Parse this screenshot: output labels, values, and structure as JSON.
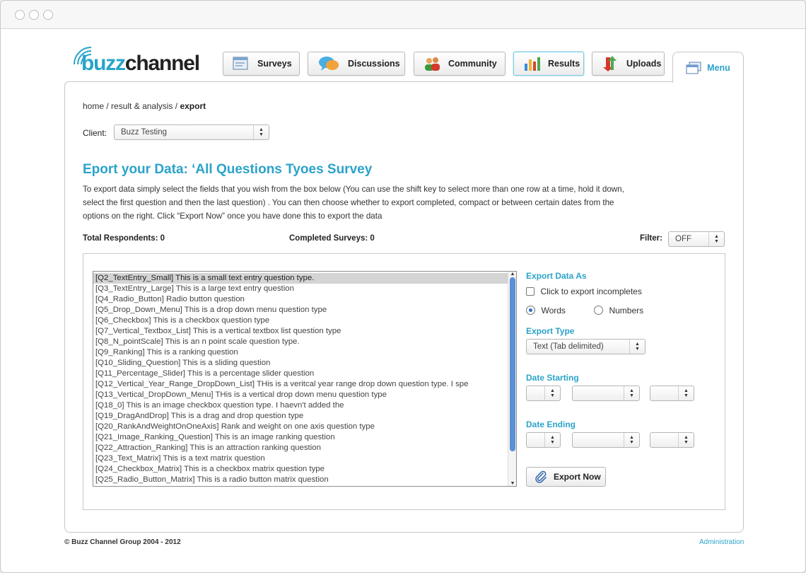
{
  "logo": {
    "part1": "buzz",
    "part2": "channel"
  },
  "nav": {
    "surveys": "Surveys",
    "discussions": "Discussions",
    "community": "Community",
    "results": "Results",
    "uploads": "Uploads",
    "menu": "Menu"
  },
  "breadcrumb": {
    "home": "home",
    "sep1": " / ",
    "section": "result & analysis",
    "sep2": " / ",
    "current": "export"
  },
  "client": {
    "label": "Client:",
    "value": "Buzz Testing"
  },
  "heading": "Eport your Data: ‘All Questions Tyoes Survey",
  "intro": "To export data simply select the fields that you wish from the box below (You can use the shift key to select more than one row at a time, hold it down, select the first question and then the last question) . You can then choose whether to export completed, compact or between certain dates from the options on the right. Click “Export Now” once you have done this to export the data",
  "stats": {
    "total_respondents": "Total Respondents: 0",
    "completed_surveys": "Completed Surveys: 0"
  },
  "filter": {
    "label": "Filter:",
    "value": "OFF"
  },
  "questions": [
    "[Q2_TextEntry_Small] This is a small text entry question type.",
    "[Q3_TextEntry_Large] This is a large text entry question",
    "[Q4_Radio_Button] Radio button question",
    "[Q5_Drop_Down_Menu] This is a drop down menu question type",
    "[Q6_Checkbox] This is a checkbox question type",
    "[Q7_Vertical_Textbox_List] This is a vertical textbox list question type",
    "[Q8_N_pointScale] This is an n point scale question type.",
    "[Q9_Ranking] This is a ranking question",
    "[Q10_Sliding_Question] This is a sliding question",
    "[Q11_Percentage_Slider] This is a percentage slider question",
    "[Q12_Vertical_Year_Range_DropDown_List] THis is a veritcal year range drop down question type. I spe",
    "[Q13_Vertical_DropDown_Menu] THis is a vertical drop down menu question type",
    "[Q18_0] This is an image checkbox question type. I haevn't added the",
    "[Q19_DragAndDrop] This is a drag and drop question type",
    "[Q20_RankAndWeightOnOneAxis] Rank and weight on one axis question type",
    "[Q21_Image_Ranking_Question] This is an image ranking question",
    "[Q22_Attraction_Ranking] This is an attraction ranking question",
    "[Q23_Text_Matrix] This is a text matrix question",
    "[Q24_Checkbox_Matrix] This is a checkbox matrix question type",
    "[Q25_Radio_Button_Matrix] This is a radio button matrix question"
  ],
  "export_options": {
    "export_as_label": "Export Data As",
    "incompletes_label": "Click to export incompletes",
    "words_label": "Words",
    "numbers_label": "Numbers",
    "selected_format": "Words",
    "export_type_label": "Export Type",
    "export_type_value": "Text (Tab delimited)",
    "date_starting_label": "Date Starting",
    "date_ending_label": "Date Ending",
    "export_button": "Export Now"
  },
  "footer": {
    "copyright": "© Buzz Channel Group 2004 - 2012",
    "admin_link": "Administration"
  },
  "colors": {
    "accent": "#2ba3c9",
    "selection": "#d4d4d4",
    "scroll_thumb": "#5b8fd6"
  }
}
